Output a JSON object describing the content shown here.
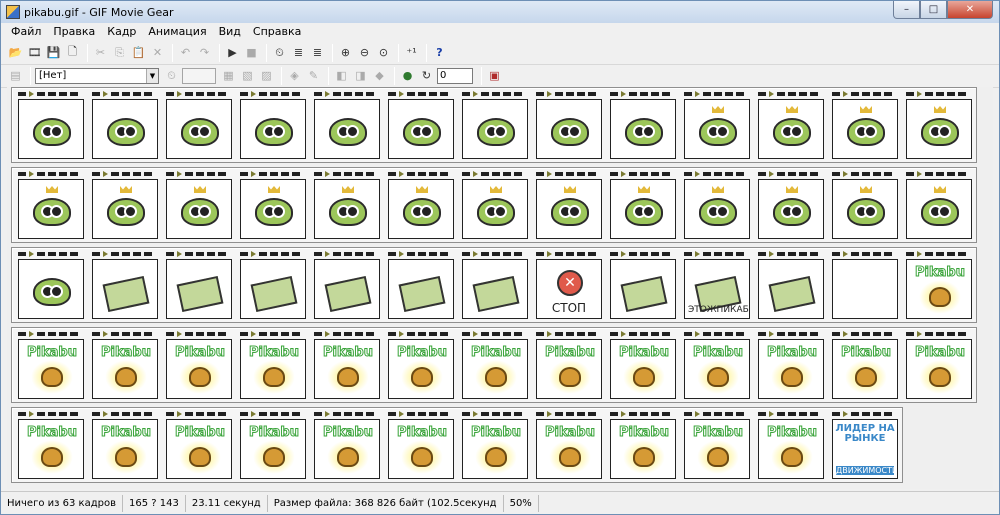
{
  "window": {
    "title": "pikabu.gif - GIF Movie Gear",
    "minimize": "–",
    "maximize": "□",
    "close": "✕"
  },
  "menu": [
    "Файл",
    "Правка",
    "Кадр",
    "Анимация",
    "Вид",
    "Справка"
  ],
  "toolbar1": {
    "icons": [
      "open-icon",
      "film-icon",
      "save-icon",
      "new-icon",
      "cut-icon",
      "copy-icon",
      "paste-icon",
      "delete-icon",
      "undo-icon",
      "redo-icon",
      "play-icon",
      "stop-icon",
      "timer-icon",
      "film-edit-icon",
      "film-optimize-icon",
      "zoom-in-icon",
      "zoom-out-icon",
      "zoom-fit-icon",
      "frame-count-icon",
      "help-icon"
    ],
    "glyphs": [
      "📂",
      "🎞",
      "💾",
      "🗋",
      "✂",
      "⎘",
      "📋",
      "✕",
      "↶",
      "↷",
      "▶",
      "■",
      "⏲",
      "≣",
      "≣",
      "⊕",
      "⊖",
      "⊙",
      "⁺¹",
      "?"
    ]
  },
  "toolbar2": {
    "palette_select": "[Нет]",
    "loop_value": "0"
  },
  "frames": {
    "row1": [
      "frog",
      "frog",
      "frog",
      "frog",
      "frog",
      "frog",
      "frog",
      "frog",
      "frog",
      "frog",
      "frog",
      "frog",
      "frog"
    ],
    "row2": [
      "frog",
      "frog",
      "frog",
      "frog",
      "frog",
      "frog",
      "frog",
      "frog",
      "frog",
      "frog",
      "frog",
      "frog",
      "frog"
    ],
    "row3": [
      "frog",
      "box",
      "box",
      "box",
      "box",
      "box",
      "box",
      "stop",
      "box",
      "box",
      "box",
      "blank",
      "pikabu"
    ],
    "row4": [
      "pikabu",
      "pikabu",
      "pikabu",
      "pikabu",
      "pikabu",
      "pikabu",
      "pikabu",
      "pikabu",
      "pikabu",
      "pikabu",
      "pikabu",
      "pikabu",
      "pikabu"
    ],
    "row5": [
      "pikabu",
      "pikabu",
      "pikabu",
      "pikabu",
      "pikabu",
      "pikabu",
      "pikabu",
      "pikabu",
      "pikabu",
      "pikabu",
      "pikabu",
      "leader"
    ]
  },
  "frame_texts": {
    "pikabu": "Pikabu",
    "stop": "✕",
    "stop_caption": "СТОП",
    "box_caption": "ЭТОЖПИКАБУ",
    "leader": "ЛИДЕР НА РЫНКЕ",
    "leader_sub": "ДВИЖИМОСТИ"
  },
  "status": {
    "selection": "Ничего из 63 кадров",
    "size": "165 ? 143",
    "duration": "23.11 секунд",
    "filesize": "Размер файла: 368 826 байт  (102.5секунд",
    "zoom": "50%"
  }
}
